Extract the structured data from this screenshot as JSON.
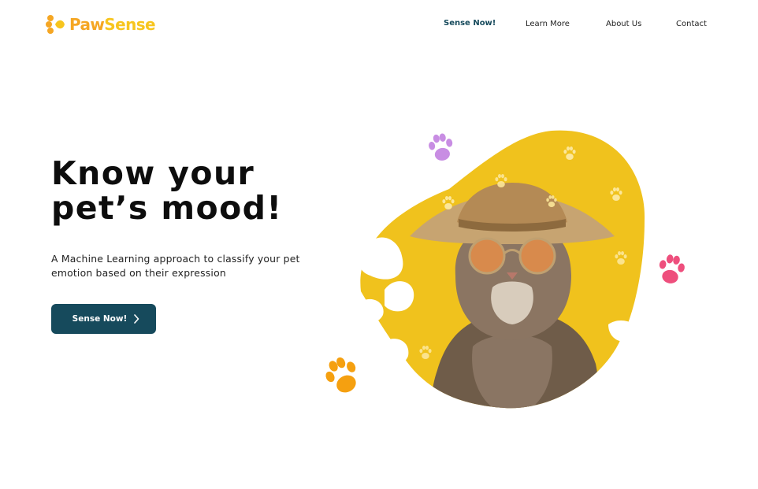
{
  "brand": {
    "name_part1": "Paw",
    "name_part2": "Sense",
    "primary_color": "#f5a623",
    "secondary_color": "#f7c51e"
  },
  "nav": {
    "items": [
      {
        "label": "Sense Now!",
        "active": true
      },
      {
        "label": "Learn More",
        "active": false
      },
      {
        "label": "About Us",
        "active": false
      },
      {
        "label": "Contact",
        "active": false
      }
    ]
  },
  "hero": {
    "title_line1": "Know your",
    "title_line2": "pet’s mood!",
    "subtitle": "A Machine Learning approach to classify your pet emotion based on their expression",
    "cta_label": "Sense Now!",
    "cta_icon": "chevron-right-icon",
    "cta_color": "#164a5c",
    "blob_color": "#f0c21d",
    "paw_colors": {
      "purple": "#c88de3",
      "pink": "#ee4f7d",
      "orange": "#f5a010"
    }
  }
}
